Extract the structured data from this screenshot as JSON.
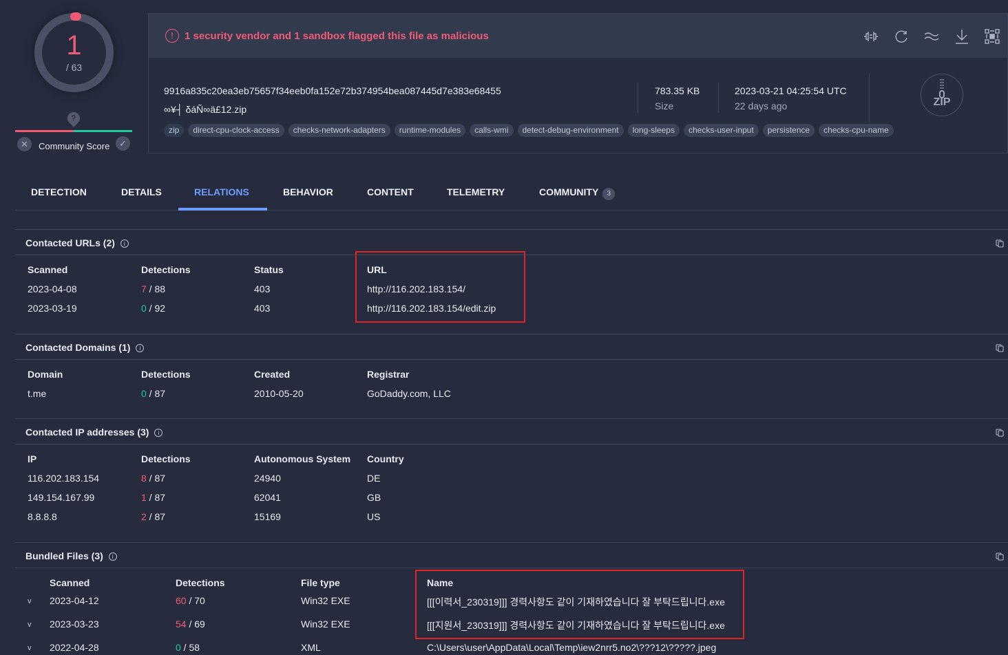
{
  "score": {
    "detected": "1",
    "total": "/ 63",
    "community_label": "Community Score",
    "unknown": "?",
    "dislike": "✕",
    "like": "✓"
  },
  "alert": {
    "text": "1 security vendor and 1 sandbox flagged this file as malicious",
    "icon": "!"
  },
  "toolbar": [
    "compare-icon",
    "reanalyze-icon",
    "similar-icon",
    "download-icon",
    "graph-icon"
  ],
  "file": {
    "hash": "9916a835c20ea3eb75657f34eeb0fa152e72b374954bea087445d7e383e68455",
    "name": "∞¥┤ δáÑ∞ä£12.zip",
    "size": "783.35 KB",
    "size_label": "Size",
    "date": "2023-03-21 04:25:54 UTC",
    "date_ago": "22 days ago",
    "type_badge": "ZIP",
    "tags": [
      "zip",
      "direct-cpu-clock-access",
      "checks-network-adapters",
      "runtime-modules",
      "calls-wmi",
      "detect-debug-environment",
      "long-sleeps",
      "checks-user-input",
      "persistence",
      "checks-cpu-name"
    ]
  },
  "tabs": [
    {
      "label": "DETECTION"
    },
    {
      "label": "DETAILS"
    },
    {
      "label": "RELATIONS",
      "active": true
    },
    {
      "label": "BEHAVIOR"
    },
    {
      "label": "CONTENT"
    },
    {
      "label": "TELEMETRY"
    },
    {
      "label": "COMMUNITY",
      "count": "3"
    }
  ],
  "urls": {
    "title": "Contacted URLs  (2)",
    "headers": [
      "Scanned",
      "Detections",
      "Status",
      "URL"
    ],
    "rows": [
      {
        "scanned": "2023-04-08",
        "det": "7",
        "tot": " / 88",
        "status": "403",
        "url": "http://116.202.183.154/"
      },
      {
        "scanned": "2023-03-19",
        "det": "0",
        "tot": " / 92",
        "status": "403",
        "url": "http://116.202.183.154/edit.zip"
      }
    ]
  },
  "domains": {
    "title": "Contacted Domains  (1)",
    "headers": [
      "Domain",
      "Detections",
      "Created",
      "Registrar"
    ],
    "rows": [
      {
        "domain": "t.me",
        "det": "0",
        "tot": " / 87",
        "created": "2010-05-20",
        "registrar": "GoDaddy.com, LLC"
      }
    ]
  },
  "ips": {
    "title": "Contacted IP addresses  (3)",
    "headers": [
      "IP",
      "Detections",
      "Autonomous System",
      "Country"
    ],
    "rows": [
      {
        "ip": "116.202.183.154",
        "det": "8",
        "tot": " / 87",
        "as": "24940",
        "country": "DE"
      },
      {
        "ip": "149.154.167.99",
        "det": "1",
        "tot": " / 87",
        "as": "62041",
        "country": "GB"
      },
      {
        "ip": "8.8.8.8",
        "det": "2",
        "tot": " / 87",
        "as": "15169",
        "country": "US"
      }
    ]
  },
  "bundled": {
    "title": "Bundled Files  (3)",
    "headers": [
      "Scanned",
      "Detections",
      "File type",
      "Name"
    ],
    "rows": [
      {
        "scanned": "2023-04-12",
        "det": "60",
        "tot": " / 70",
        "type": "Win32 EXE",
        "name": "[[[이력서_230319]]] 경력사항도 같이 기재하였습니다 잘 부탁드립니다.exe"
      },
      {
        "scanned": "2023-03-23",
        "det": "54",
        "tot": " / 69",
        "type": "Win32 EXE",
        "name": "[[[지원서_230319]]] 경력사항도 같이 기재하였습니다 잘 부탁드립니다.exe"
      },
      {
        "scanned": "2022-04-28",
        "det": "0",
        "tot": " / 58",
        "type": "XML",
        "name": "C:\\Users\\user\\AppData\\Local\\Temp\\iew2nrr5.no2\\???12\\?????.jpeg"
      }
    ]
  },
  "colors": {
    "malicious": "#ef5b74",
    "clean": "#1ec9a0",
    "accent": "#6f9cff",
    "highlight": "#e02424"
  }
}
